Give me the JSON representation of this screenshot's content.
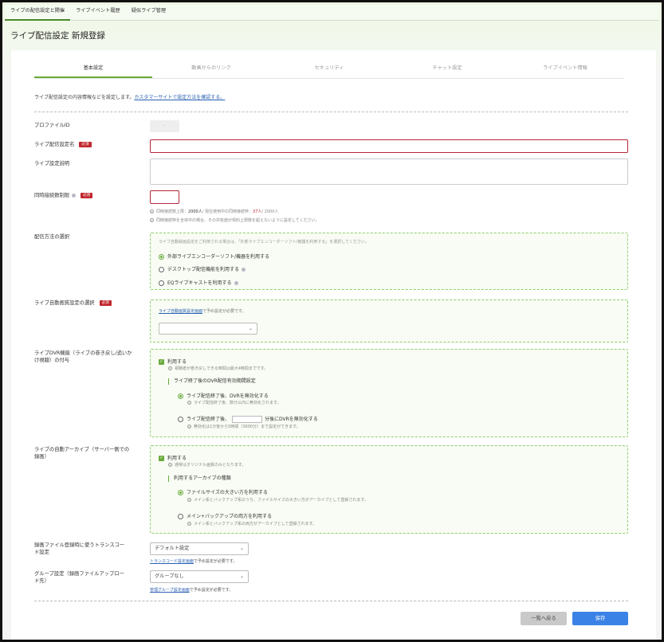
{
  "nav": {
    "items": [
      "ライブの配信設定と開催",
      "ライブイベント履歴",
      "疑似ライブ管理"
    ]
  },
  "page_title": "ライブ配信設定 新規登録",
  "tabs": [
    "基本設定",
    "動画からのリンク",
    "セキュリティ",
    "チャット設定",
    "ライブイベント情報"
  ],
  "intro": {
    "text": "ライブ配信設定の内容情報などを設定します。",
    "link": "カスタマーサイトで設定方法を確認する。"
  },
  "required_badge": "必須",
  "profile": {
    "label": "プロファイルID",
    "value": "-"
  },
  "name": {
    "label": "ライブ配信設定名"
  },
  "desc": {
    "label": "ライブ設定説明"
  },
  "concurrent": {
    "label": "同時接続数制限",
    "note1_a": "同時接続数上限：",
    "note1_b": "2000人",
    "note1_c": "/ 現在使用中の同時接続枠：",
    "note1_d": "37人",
    "note1_e": "/ 2000人",
    "note2": "同時接続枠を全体中の場合、その共有値が契約上限数を超えないように設定してください。"
  },
  "method": {
    "label": "配信方法の選択",
    "hint": "ライブ自動録画設定をご利用される場合は、「外部ライブエンコーダーソフト/機器を利用する」を選択してください。",
    "options": [
      "外部ライブエンコーダーソフト/機器を利用する",
      "デスクトップ配信機能を利用する",
      "EQライブキャストを利用する"
    ]
  },
  "autorec": {
    "label": "ライブ自動画質設定の選択",
    "link": "ライブ自動画質設定画面",
    "text": "で予め設定が必要です。"
  },
  "dvr": {
    "label": "ライブDVR機能（ライブの巻き戻し/追いかけ視聴）の付与",
    "use": "利用する",
    "use_note": "視聴者が巻き戻しできる時間は最大4時間までです。",
    "sub_title": "ライブ終了後のDVR配信有効期間設定",
    "opt1": "ライブ配信終了後、DVRを無効化する",
    "opt1_note": "ライブ配信終了後、数分以内に無効化されます。",
    "opt2_a": "ライブ配信終了後、",
    "opt2_b": "分後にDVRを無効化する",
    "opt2_note": "無効化は1分後から5時間（3600分）まで設定ができます。"
  },
  "archive": {
    "label": "ライブの自動アーカイブ（サーバー側での録画）",
    "use": "利用する",
    "use_note": "通常はオリジナル画質のみとなります。",
    "sub_title": "利用するアーカイブの種類",
    "opt1": "ファイルサイズの大きい方を利用する",
    "opt1_note": "メイン系とバックアップ系のうち、ファイルサイズの大きい方がアーカイブとして登録されます。",
    "opt2": "メイン+バックアップの両方を利用する",
    "opt2_note": "メイン系とバックアップ系の両方がアーカイブとして登録されます。"
  },
  "transcode": {
    "label": "録画ファイル登録時に使うトランスコード設定",
    "value": "デフォルト設定",
    "link": "トランスコード設定画面",
    "text": "で予め設定が必要です。"
  },
  "group": {
    "label": "グループ設定（録画ファイルアップロード先）",
    "value": "グループなし",
    "link": "管理グループ設定画面",
    "text": "で予め設定が必要です。"
  },
  "buttons": {
    "back": "一覧へ戻る",
    "save": "保存"
  }
}
